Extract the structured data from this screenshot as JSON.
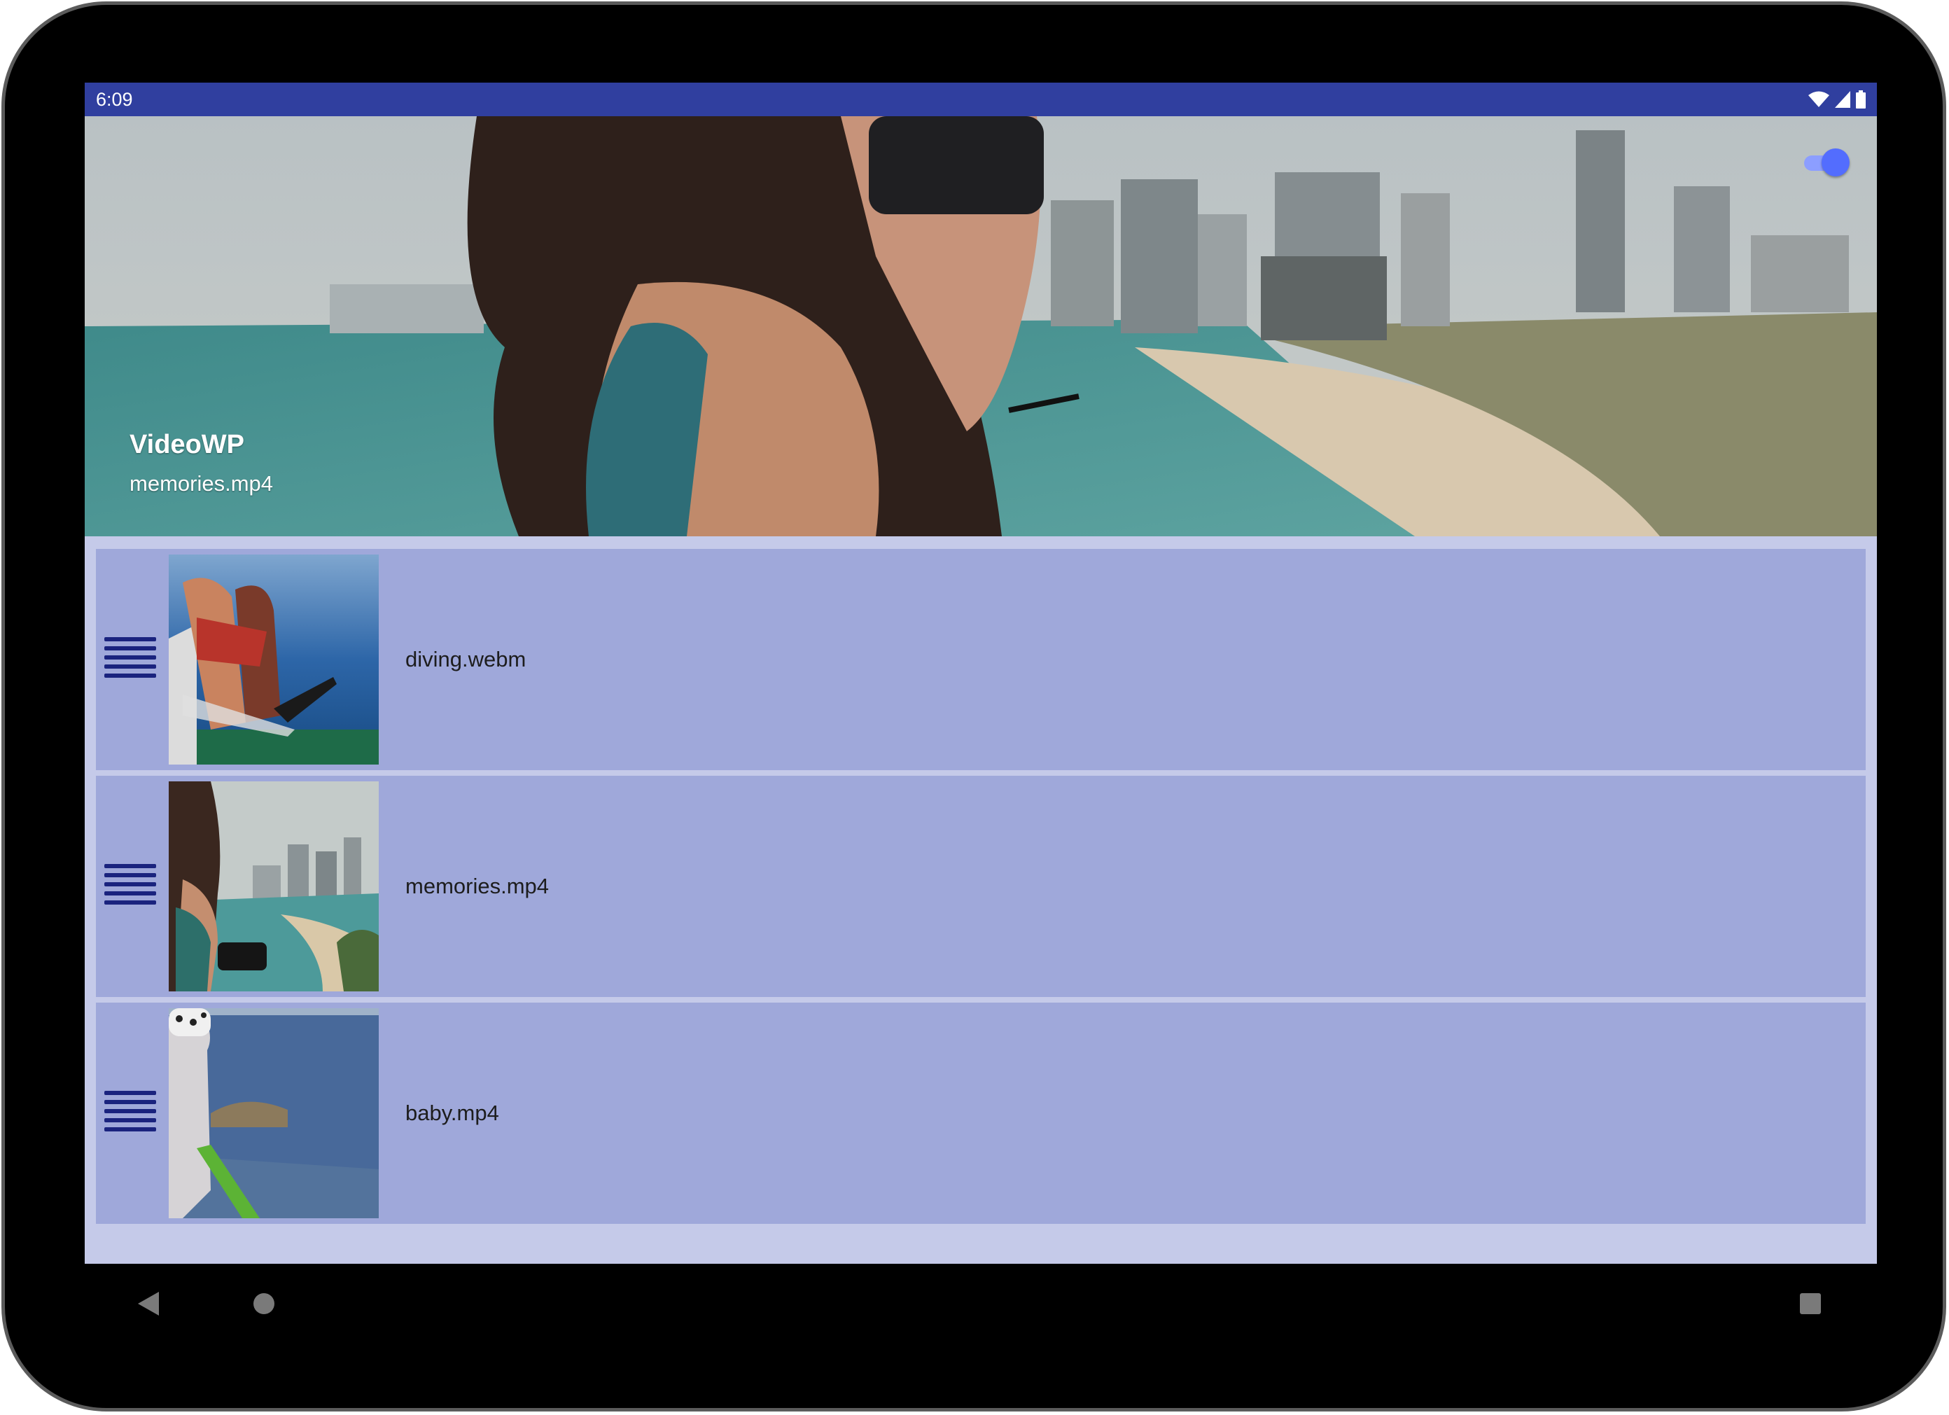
{
  "status_bar": {
    "time": "6:09",
    "icons": [
      "wifi-icon",
      "signal-icon",
      "battery-icon"
    ]
  },
  "header": {
    "title": "VideoWP",
    "subtitle": "memories.mp4",
    "toggle_on": true
  },
  "playlist": {
    "items": [
      {
        "label": "diving.webm",
        "thumbnail": "diving"
      },
      {
        "label": "memories.mp4",
        "thumbnail": "memories"
      },
      {
        "label": "baby.mp4",
        "thumbnail": "baby"
      }
    ]
  },
  "nav_bar": {
    "buttons": [
      "back-icon",
      "home-icon",
      "recents-icon"
    ]
  },
  "colors": {
    "status_bar": "#303f9f",
    "list_background": "#c5cae9",
    "row_background": "#9fa8da",
    "drag_handle": "#1a237e",
    "toggle_track": "#8c9eff",
    "toggle_thumb": "#536dfe"
  }
}
